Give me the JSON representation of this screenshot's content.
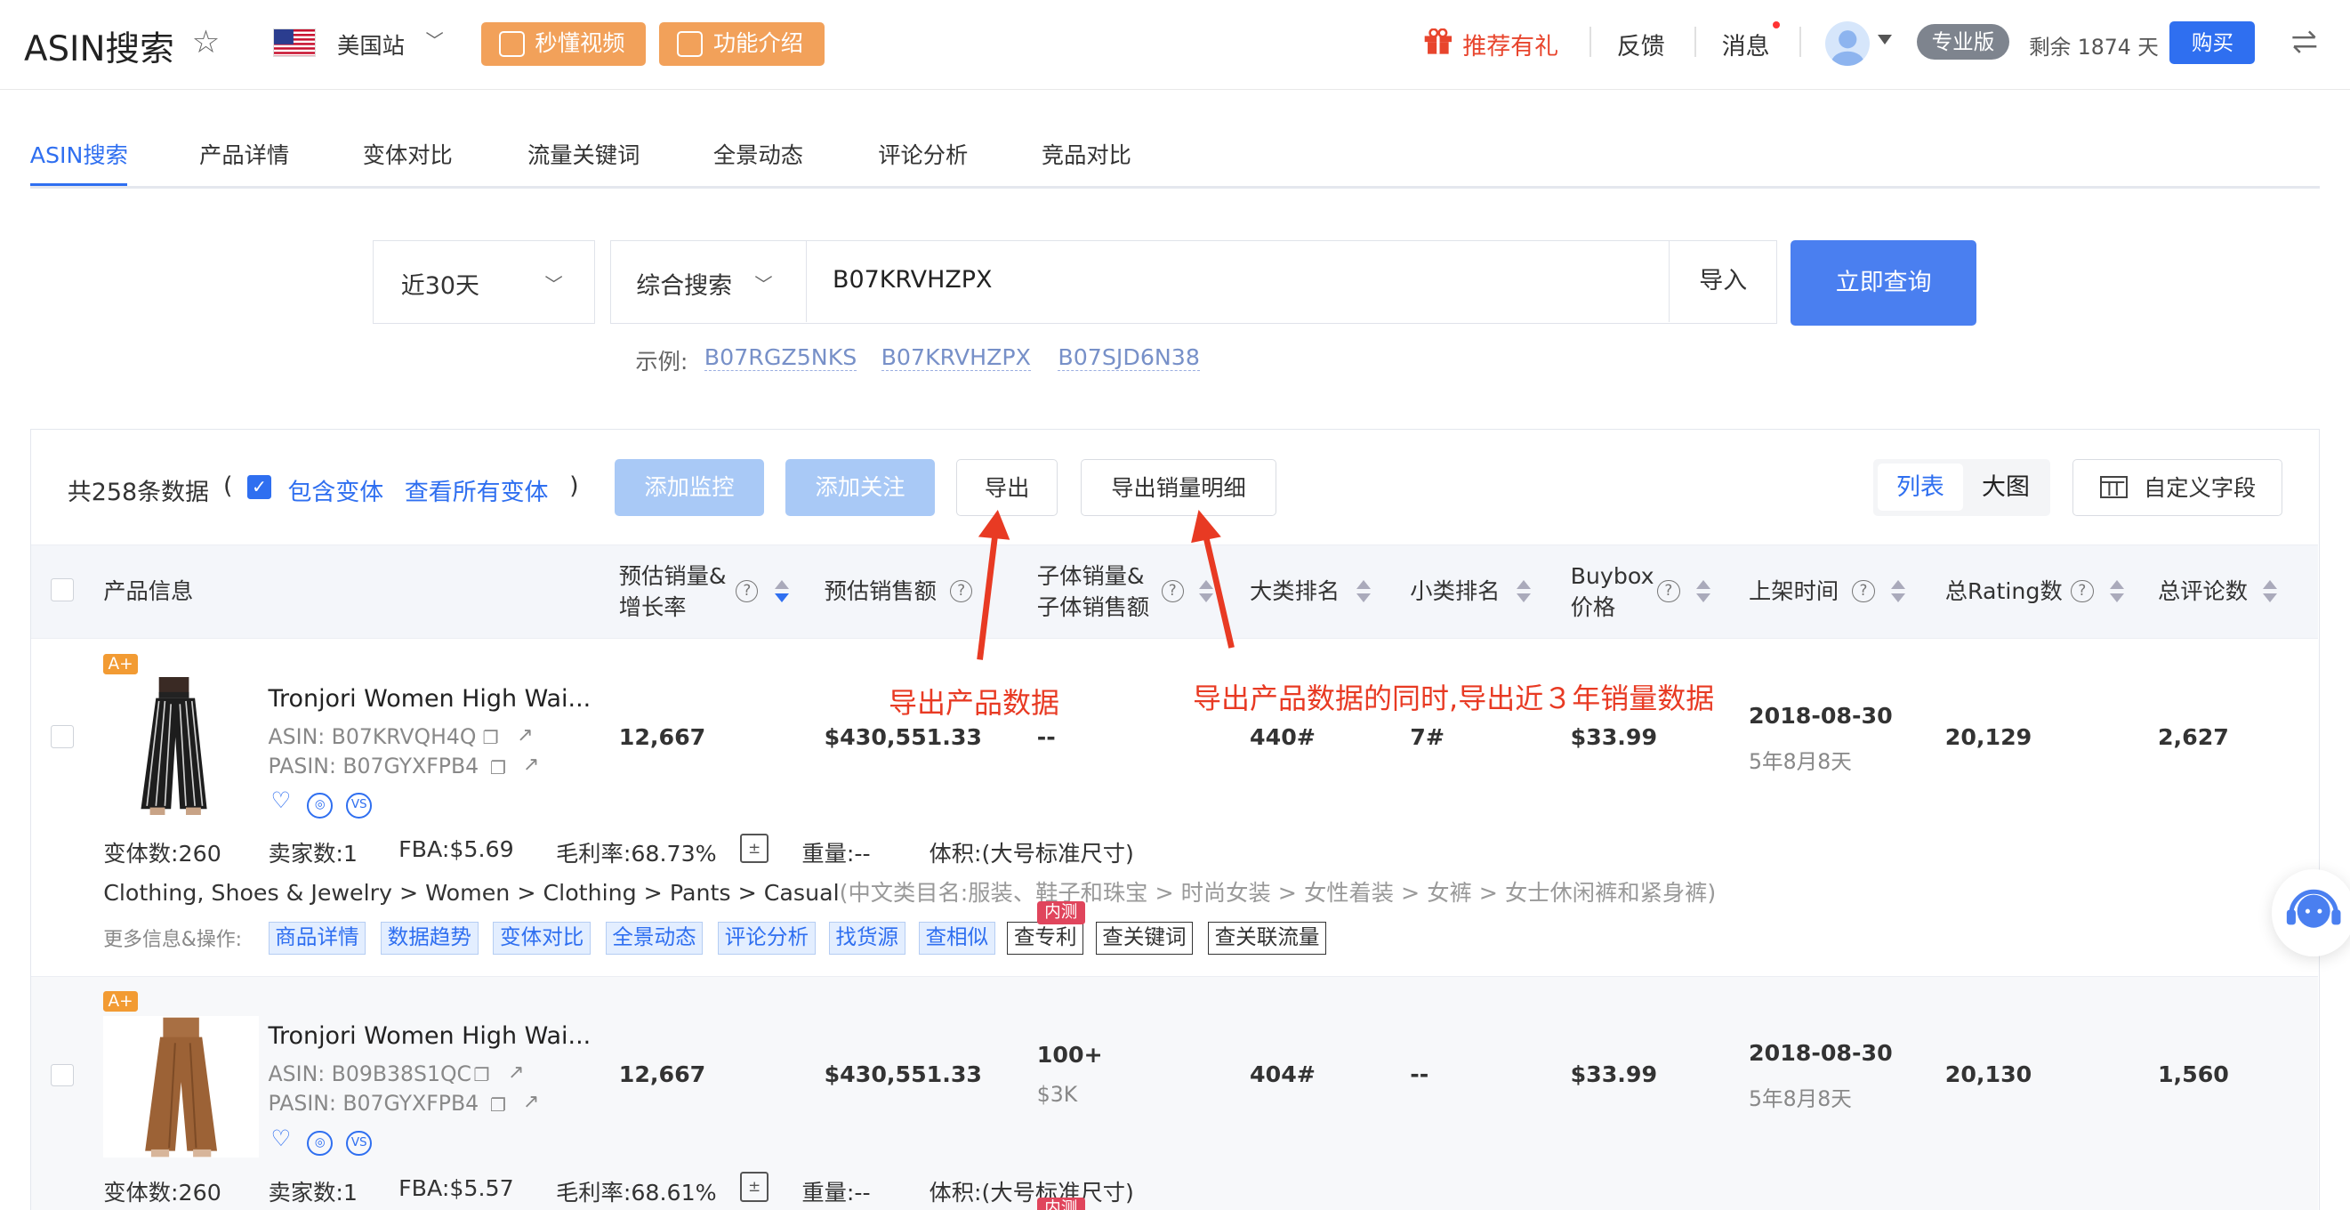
{
  "header": {
    "title": "ASIN搜索",
    "site": "美国站",
    "video_btn": "秒懂视频",
    "intro_btn": "功能介绍",
    "gift": "推荐有礼",
    "feedback": "反馈",
    "messages": "消息",
    "plan": "专业版",
    "remaining": "剩余 1874 天",
    "buy": "购买"
  },
  "tabs": [
    "ASIN搜索",
    "产品详情",
    "变体对比",
    "流量关键词",
    "全景动态",
    "评论分析",
    "竞品对比"
  ],
  "search": {
    "period": "近30天",
    "mode": "综合搜索",
    "query": "B07KRVHZPX",
    "import": "导入",
    "submit": "立即查询",
    "example_label": "示例:",
    "examples": [
      "B07RGZ5NKS",
      "B07KRVHZPX",
      "B07SJD6N38"
    ]
  },
  "toolbar": {
    "total": "共258条数据",
    "paren_open": "(",
    "paren_close": ")",
    "include_variants": "包含变体",
    "view_variants": "查看所有变体",
    "add_monitor": "添加监控",
    "add_follow": "添加关注",
    "export": "导出",
    "export_detail": "导出销量明细",
    "view_list": "列表",
    "view_big": "大图",
    "custom_fields": "自定义字段"
  },
  "columns": {
    "product": "产品信息",
    "est_sales_1": "预估销量&",
    "est_sales_2": "增长率",
    "est_revenue": "预估销售额",
    "child_1": "子体销量&",
    "child_2": "子体销售额",
    "big_rank": "大类排名",
    "small_rank": "小类排名",
    "buybox_1": "Buybox",
    "buybox_2": "价格",
    "listed": "上架时间",
    "ratings": "总Rating数",
    "reviews": "总评论数"
  },
  "annotations": {
    "export_note": "导出产品数据",
    "export_detail_note": "导出产品数据的同时,导出近３年销量数据"
  },
  "rows": [
    {
      "badge": "A+",
      "title": "Tronjori Women High Wai...",
      "asin": "ASIN: B07KRVQH4Q",
      "pasin": "PASIN: B07GYXFPB4",
      "sales": "12,667",
      "revenue": "$430,551.33",
      "child_sales": "--",
      "child_revenue": "",
      "big_rank": "440#",
      "small_rank": "7#",
      "price": "$33.99",
      "listed": "2018-08-30",
      "listed_age": "5年8月8天",
      "ratings": "20,129",
      "reviews": "2,627",
      "variants": "变体数:260",
      "sellers": "卖家数:1",
      "fba": "FBA:$5.69",
      "margin": "毛利率:68.73%",
      "weight": "重量:--",
      "volume": "体积:(大号标准尺寸)",
      "category": "Clothing, Shoes & Jewelry > Women > Clothing > Pants > Casual",
      "category_cn": "(中文类目名:服装、鞋子和珠宝 > 时尚女装 > 女性着装 > 女裤 > 女士休闲裤和紧身裤)",
      "more_label": "更多信息&操作:",
      "tags": [
        "商品详情",
        "数据趋势",
        "变体对比",
        "全景动态",
        "评论分析",
        "找货源",
        "查相似"
      ],
      "white_tags": [
        "查专利",
        "查关键词",
        "查关联流量"
      ],
      "beta": "内测"
    },
    {
      "badge": "A+",
      "title": "Tronjori Women High Wai...",
      "asin": "ASIN: B09B38S1QC",
      "pasin": "PASIN: B07GYXFPB4",
      "sales": "12,667",
      "revenue": "$430,551.33",
      "child_sales": "100+",
      "child_revenue": "$3K",
      "big_rank": "404#",
      "small_rank": "--",
      "price": "$33.99",
      "listed": "2018-08-30",
      "listed_age": "5年8月8天",
      "ratings": "20,130",
      "reviews": "1,560",
      "variants": "变体数:260",
      "sellers": "卖家数:1",
      "fba": "FBA:$5.57",
      "margin": "毛利率:68.61%",
      "weight": "重量:--",
      "volume": "体积:(大号标准尺寸)",
      "beta": "内测"
    }
  ],
  "colors": {
    "accent": "#2f6ff0",
    "orange": "#f2a15a",
    "annotation": "#e83a23"
  }
}
